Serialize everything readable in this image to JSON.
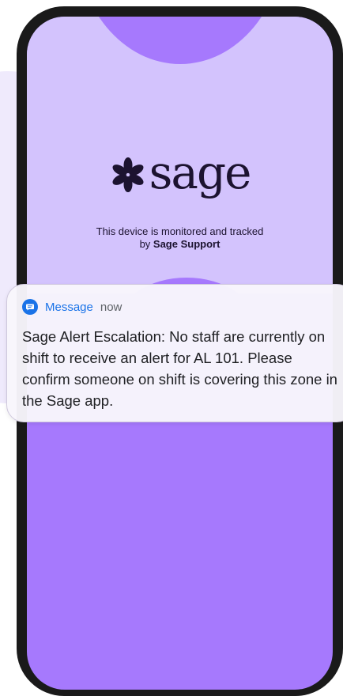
{
  "brand": {
    "logo_text": "sage",
    "logo_icon": "flower-asterisk-icon"
  },
  "lockscreen": {
    "monitor_line1": "This device is monitored and tracked",
    "monitor_by": "by ",
    "monitor_org": "Sage Support"
  },
  "notification": {
    "icon": "message-icon",
    "app_name": "Message",
    "time": "now",
    "body": "Sage Alert Escalation: No staff are currently on shift to receive an alert for AL 101. Please confirm someone on shift is covering this zone in the Sage app."
  },
  "colors": {
    "screen_top": "#d3c3fd",
    "screen_bottom": "#a679fd",
    "accent": "#1a73e8",
    "frame": "#1a1a1a"
  }
}
